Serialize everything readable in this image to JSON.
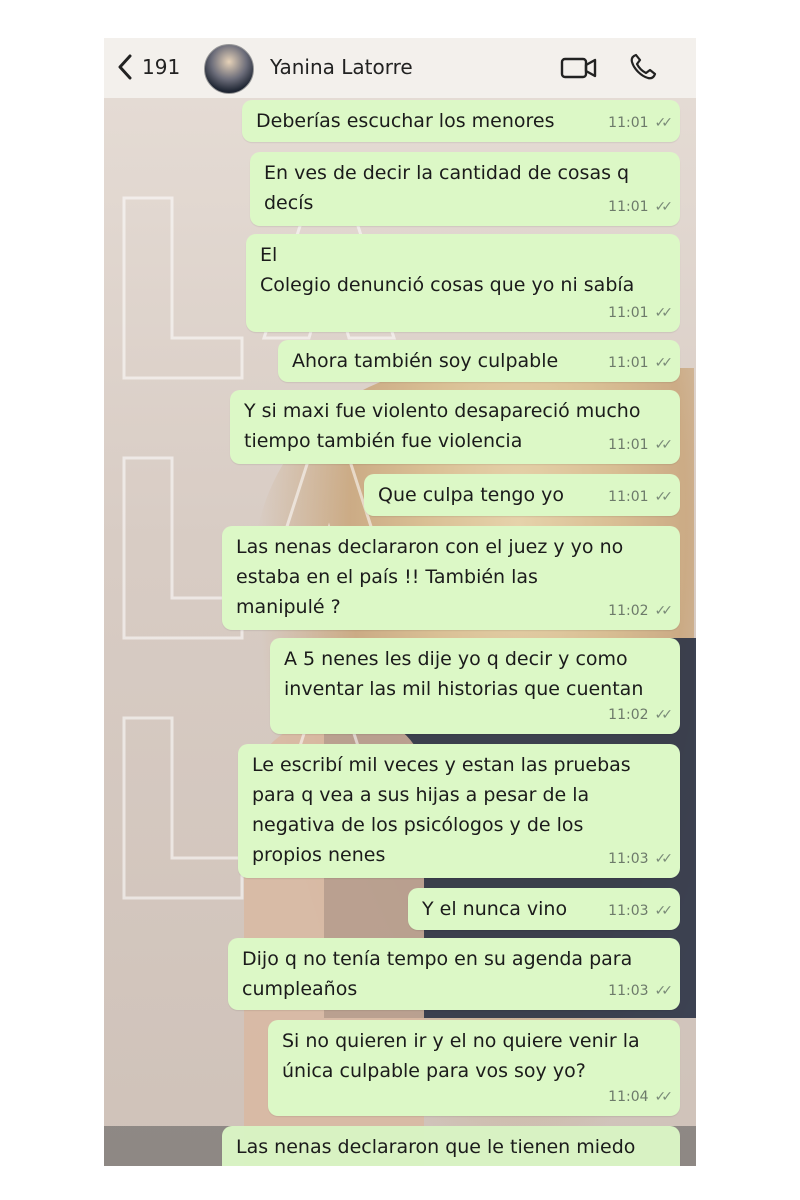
{
  "header": {
    "back_count": "191",
    "contact_name": "Yanina Latorre",
    "icons": [
      "chevron-left-icon",
      "video-call-icon",
      "phone-icon"
    ]
  },
  "messages": [
    {
      "text": "Deberías escuchar los menores",
      "time": "11:01"
    },
    {
      "text": "En ves de decir la cantidad de cosas q\ndecís",
      "time": "11:01"
    },
    {
      "text": "El\nColegio denunció cosas que yo ni sabía",
      "time": "11:01"
    },
    {
      "text": "Ahora también soy culpable",
      "time": "11:01"
    },
    {
      "text": "Y si maxi fue violento desapareció mucho\ntiempo también fue violencia",
      "time": "11:01"
    },
    {
      "text": "Que culpa tengo yo",
      "time": "11:01"
    },
    {
      "text": "Las nenas  declararon con el juez y yo no\nestaba en el país !! También las\nmanipulé ?",
      "time": "11:02"
    },
    {
      "text": "A 5 nenes les dije yo q decir y como\ninventar las mil historias que cuentan",
      "time": "11:02"
    },
    {
      "text": "Le escribí mil veces y estan las pruebas\npara q vea a sus hijas a pesar de la\nnegativa de los psicólogos y de los\npropios nenes",
      "time": "11:03"
    },
    {
      "text": "Y el nunca vino",
      "time": "11:03"
    },
    {
      "text": "Dijo q no tenía tempo en su agenda para\ncumpleaños",
      "time": "11:03"
    },
    {
      "text": "Si no quieren ir y el no quiere venir la\núnica culpable para vos soy yo?",
      "time": "11:04"
    },
    {
      "text": "Las nenas declararon que le tienen miedo",
      "time": ""
    }
  ],
  "colors": {
    "bubble": "#dcf8c6",
    "header": "#f4f0ec",
    "text": "#1b1b1b"
  }
}
